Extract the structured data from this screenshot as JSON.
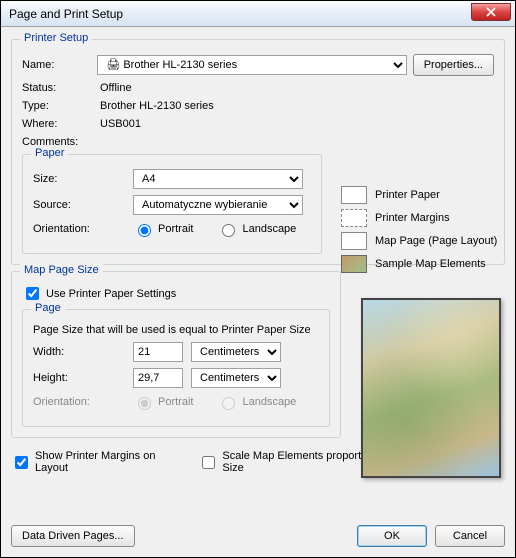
{
  "window": {
    "title": "Page and Print Setup"
  },
  "printerSetup": {
    "legend": "Printer Setup",
    "nameLabel": "Name:",
    "name": "Brother HL-2130 series",
    "propertiesBtn": "Properties...",
    "statusLabel": "Status:",
    "status": "Offline",
    "typeLabel": "Type:",
    "type": "Brother HL-2130 series",
    "whereLabel": "Where:",
    "where": "USB001",
    "commentsLabel": "Comments:",
    "paper": {
      "legend": "Paper",
      "sizeLabel": "Size:",
      "size": "A4",
      "sourceLabel": "Source:",
      "source": "Automatyczne wybieranie",
      "orientationLabel": "Orientation:",
      "portrait": "Portrait",
      "landscape": "Landscape"
    }
  },
  "legendBox": {
    "printerPaper": "Printer Paper",
    "printerMargins": "Printer Margins",
    "mapPage": "Map Page (Page Layout)",
    "sampleMap": "Sample Map Elements"
  },
  "mapPageSize": {
    "legend": "Map Page Size",
    "usePrinter": "Use Printer Paper Settings",
    "page": {
      "legend": "Page",
      "hint": "Page Size that will be used is equal to Printer Paper Size",
      "widthLabel": "Width:",
      "width": "21",
      "widthUnits": "Centimeters",
      "heightLabel": "Height:",
      "height": "29,7",
      "heightUnits": "Centimeters",
      "orientationLabel": "Orientation:",
      "portrait": "Portrait",
      "landscape": "Landscape"
    }
  },
  "bottom": {
    "showMargins": "Show Printer Margins on Layout",
    "scaleElements": "Scale Map Elements proportionally to changes in Page Size"
  },
  "buttons": {
    "dataDriven": "Data Driven Pages...",
    "ok": "OK",
    "cancel": "Cancel"
  }
}
